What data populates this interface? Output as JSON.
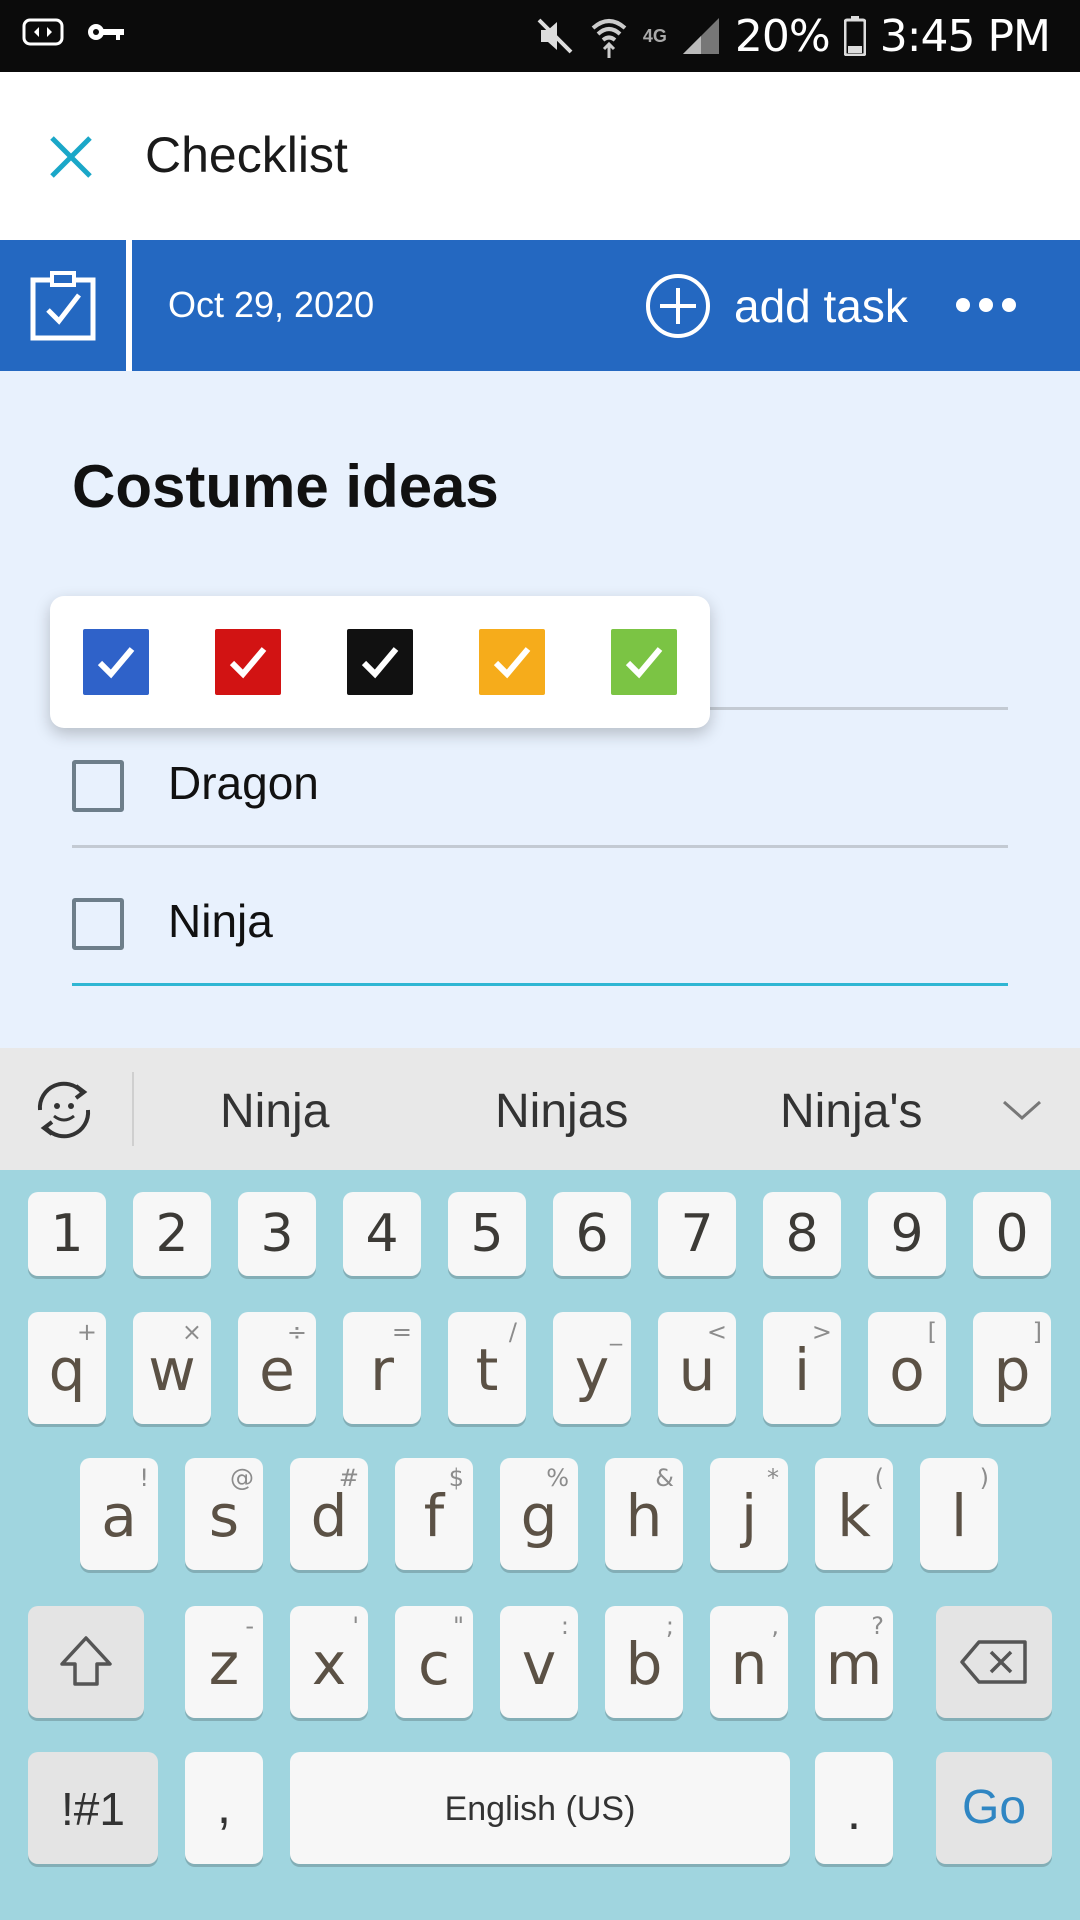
{
  "status_bar": {
    "battery": "20%",
    "time": "3:45 PM",
    "network": "4G"
  },
  "app_bar": {
    "title": "Checklist"
  },
  "toolbar": {
    "date": "Oct 29, 2020",
    "add_task_label": "add task"
  },
  "checklist": {
    "title": "Costume ideas",
    "items": [
      {
        "label": "",
        "checked": false
      },
      {
        "label": "Dragon",
        "checked": false
      },
      {
        "label": "Ninja",
        "checked": false
      }
    ]
  },
  "color_picker": {
    "colors": [
      "#2f62c9",
      "#d21313",
      "#111111",
      "#f6ac1b",
      "#7bc444"
    ]
  },
  "suggestions": [
    "Ninja",
    "Ninjas",
    "Ninja's"
  ],
  "keyboard": {
    "numbers": [
      "1",
      "2",
      "3",
      "4",
      "5",
      "6",
      "7",
      "8",
      "9",
      "0"
    ],
    "row1": [
      {
        "key": "q",
        "alt": "+"
      },
      {
        "key": "w",
        "alt": "×"
      },
      {
        "key": "e",
        "alt": "÷"
      },
      {
        "key": "r",
        "alt": "="
      },
      {
        "key": "t",
        "alt": "/"
      },
      {
        "key": "y",
        "alt": "_"
      },
      {
        "key": "u",
        "alt": "<"
      },
      {
        "key": "i",
        "alt": ">"
      },
      {
        "key": "o",
        "alt": "["
      },
      {
        "key": "p",
        "alt": "]"
      }
    ],
    "row2": [
      {
        "key": "a",
        "alt": "!"
      },
      {
        "key": "s",
        "alt": "@"
      },
      {
        "key": "d",
        "alt": "#"
      },
      {
        "key": "f",
        "alt": "$"
      },
      {
        "key": "g",
        "alt": "%"
      },
      {
        "key": "h",
        "alt": "&"
      },
      {
        "key": "j",
        "alt": "*"
      },
      {
        "key": "k",
        "alt": "("
      },
      {
        "key": "l",
        "alt": ")"
      }
    ],
    "row3": [
      {
        "key": "z",
        "alt": "-"
      },
      {
        "key": "x",
        "alt": "'"
      },
      {
        "key": "c",
        "alt": "\""
      },
      {
        "key": "v",
        "alt": ":"
      },
      {
        "key": "b",
        "alt": ";"
      },
      {
        "key": "n",
        "alt": ","
      },
      {
        "key": "m",
        "alt": "?"
      }
    ],
    "symbols_label": "!#1",
    "comma": ",",
    "space_label": "English (US)",
    "period": ".",
    "go_label": "Go"
  }
}
